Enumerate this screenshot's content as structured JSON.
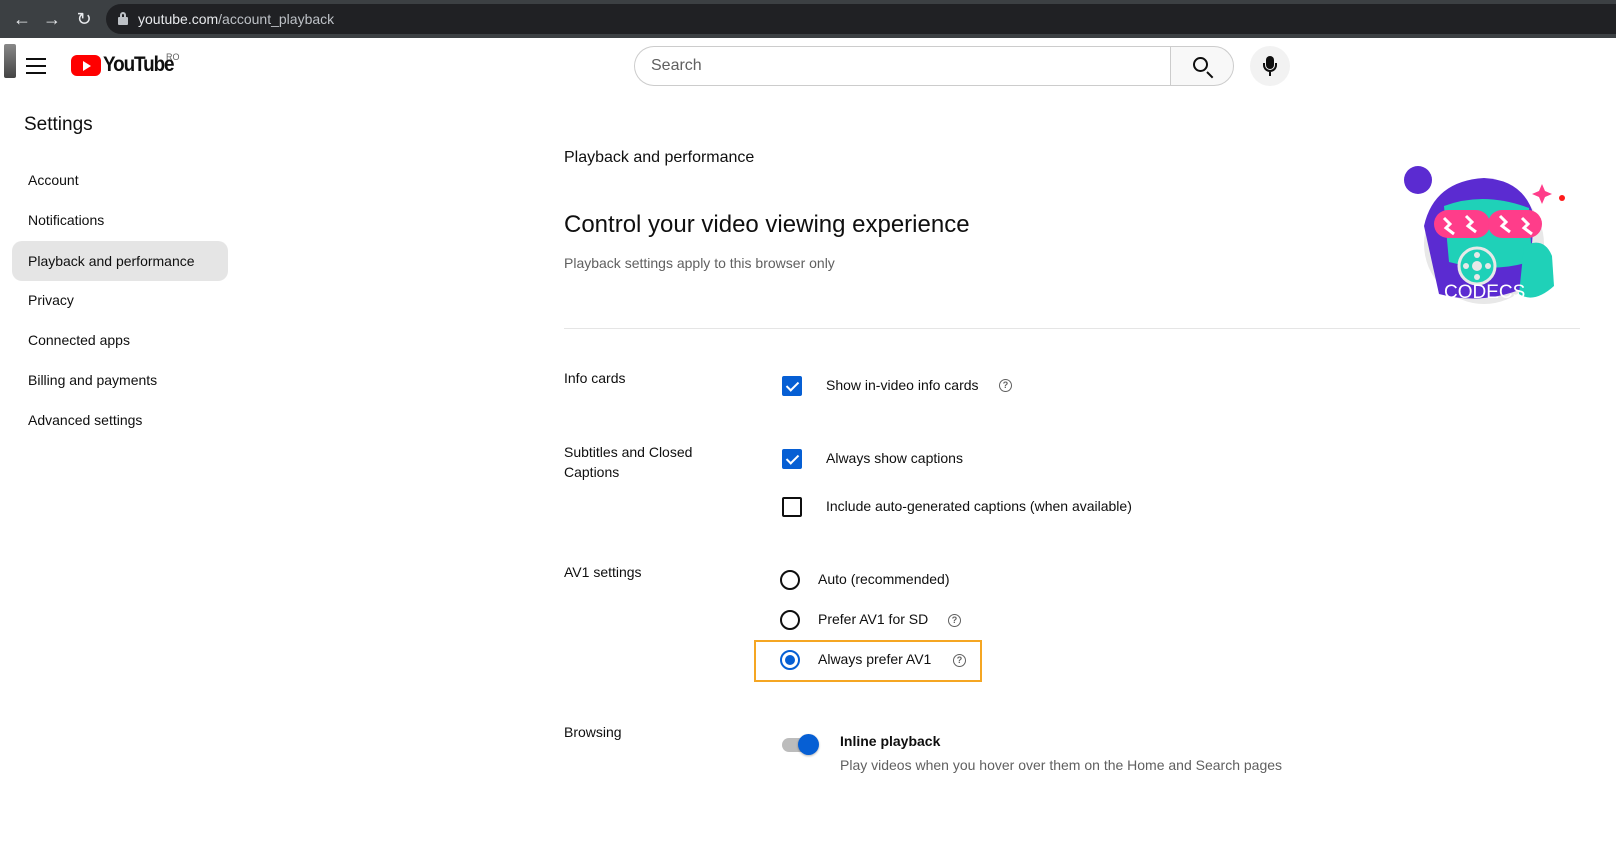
{
  "browser": {
    "url_host": "youtube.com",
    "url_path": "/account_playback"
  },
  "masthead": {
    "logo_text": "YouTube",
    "region": "RO",
    "search_placeholder": "Search"
  },
  "sidebar": {
    "title": "Settings",
    "items": [
      {
        "label": "Account"
      },
      {
        "label": "Notifications"
      },
      {
        "label": "Playback and performance"
      },
      {
        "label": "Privacy"
      },
      {
        "label": "Connected apps"
      },
      {
        "label": "Billing and payments"
      },
      {
        "label": "Advanced settings"
      }
    ]
  },
  "main": {
    "section_title": "Playback and performance",
    "headline": "Control your video viewing experience",
    "subline": "Playback settings apply to this browser only",
    "art_text": "CODECS",
    "info_cards": {
      "label": "Info cards",
      "option": "Show in-video info cards",
      "checked": true
    },
    "subtitles": {
      "label": "Subtitles and Closed Captions",
      "options": [
        {
          "label": "Always show captions",
          "checked": true
        },
        {
          "label": "Include auto-generated captions (when available)",
          "checked": false
        }
      ]
    },
    "av1": {
      "label": "AV1 settings",
      "options": [
        {
          "label": "Auto (recommended)",
          "selected": false
        },
        {
          "label": "Prefer AV1 for SD",
          "selected": false
        },
        {
          "label": "Always prefer AV1",
          "selected": true
        }
      ]
    },
    "browsing": {
      "label": "Browsing",
      "toggle_title": "Inline playback",
      "toggle_desc": "Play videos when you hover over them on the Home and Search pages",
      "enabled": true
    }
  },
  "colors": {
    "accent": "#065fd4",
    "highlight": "#f5a623",
    "brand": "#ff0000"
  }
}
